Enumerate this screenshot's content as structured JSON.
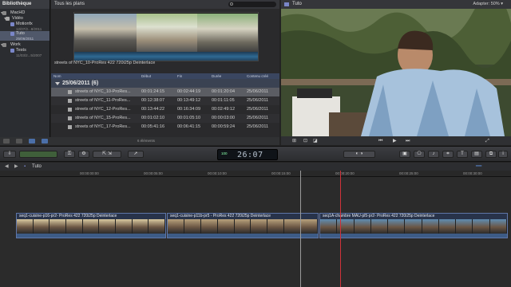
{
  "library": {
    "title": "Bibliothèque",
    "items": [
      {
        "label": "MacHD",
        "sub": ""
      },
      {
        "label": "Vidéo",
        "sub": ""
      },
      {
        "label": "Motionfx",
        "sub": "12/07/2...8/2011"
      },
      {
        "label": "Tuto",
        "sub": "25/06/2011"
      },
      {
        "label": "Work",
        "sub": ""
      },
      {
        "label": "Tests",
        "sub": "11/03/2...5/2007"
      }
    ]
  },
  "browser": {
    "filter": "Tous les plans",
    "search_placeholder": "",
    "filmstrip_label": "streets of NYC_10-ProRes 422 720i25p Deinterlace",
    "columns": [
      "Nom",
      "Début",
      "Fin",
      "Durée",
      "Contenu créé"
    ],
    "group": "25/06/2011  (6)",
    "rows": [
      [
        "streets of NYC_10-ProRes...",
        "00:01:24:15",
        "00:02:44:19",
        "00:01:20:04",
        "25/06/2011"
      ],
      [
        "streets of NYC_11-ProRes...",
        "00:12:38:07",
        "00:13:49:12",
        "00:01:11:05",
        "25/06/2011"
      ],
      [
        "streets of NYC_12-ProRes...",
        "00:13:44:22",
        "00:16:34:09",
        "00:02:49:12",
        "25/06/2011"
      ],
      [
        "streets of NYC_15-ProRes...",
        "00:01:02:10",
        "00:01:05:10",
        "00:00:03:00",
        "25/06/2011"
      ],
      [
        "streets of NYC_17-ProRes...",
        "00:05:41:16",
        "00:06:41:15",
        "00:00:59:24",
        "25/06/2011"
      ]
    ],
    "count": "6 éléments"
  },
  "viewer": {
    "title": "Tuto",
    "adapter": "Adapter:  50% ▾"
  },
  "toolbar": {
    "timecode": "26:07",
    "timecode_hint": "100"
  },
  "timeline": {
    "project": "Tuto",
    "ticks": [
      "00:00:00:00",
      "00:00:05:00",
      "00:00:10:00",
      "00:00:15:00",
      "00:00:20:00",
      "00:00:25:00",
      "00:00:30:00"
    ],
    "clips": [
      {
        "name": "seq1-cuisine-p16-pr2- ProRes 422 720i25p Deinterlace",
        "color": "#d8c9a0"
      },
      {
        "name": "seq1-cuisine-p11b-pr5 - ProRes 422 720i25p Deinterlace",
        "color": "#b7a17c"
      },
      {
        "name": "seq1A-chambre MAU-pl5-pr2- ProRes 422 720i25p Deinterlace",
        "color": "#5e8db2"
      }
    ]
  }
}
